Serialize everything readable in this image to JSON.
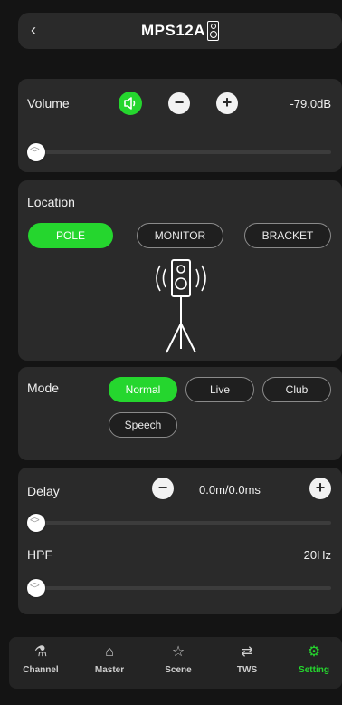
{
  "header": {
    "back_icon": "chevron-left-icon",
    "title": "MPS12A"
  },
  "volume": {
    "label": "Volume",
    "value": "-79.0dB",
    "level": 0.0,
    "mute_icon": "speaker-icon"
  },
  "location": {
    "label": "Location",
    "options": [
      "POLE",
      "MONITOR",
      "BRACKET"
    ],
    "selected": "POLE"
  },
  "mode": {
    "label": "Mode",
    "options": [
      "Normal",
      "Live",
      "Club",
      "Speech"
    ],
    "selected": "Normal"
  },
  "delay": {
    "label": "Delay",
    "value": "0.0m/0.0ms",
    "level": 0.0
  },
  "hpf": {
    "label": "HPF",
    "value": "20Hz",
    "level": 0.0
  },
  "tabs": [
    {
      "label": "Channel",
      "icon": "channel-icon"
    },
    {
      "label": "Master",
      "icon": "home-icon"
    },
    {
      "label": "Scene",
      "icon": "star-icon"
    },
    {
      "label": "TWS",
      "icon": "tws-icon"
    },
    {
      "label": "Setting",
      "icon": "gear-icon"
    }
  ],
  "active_tab": "Setting",
  "colors": {
    "accent": "#25d62e",
    "card": "#2a2a2a",
    "background": "#141414"
  }
}
